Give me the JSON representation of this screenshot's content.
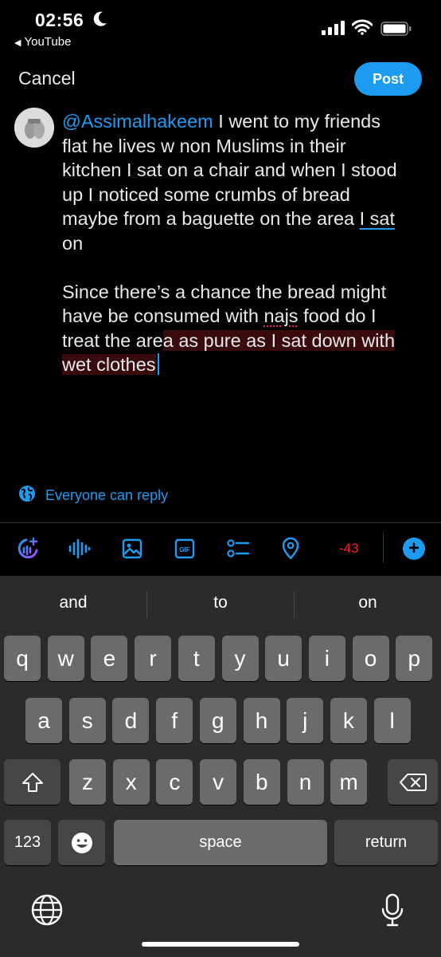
{
  "status": {
    "time": "02:56",
    "back_app": "YouTube"
  },
  "header": {
    "cancel_label": "Cancel",
    "post_label": "Post"
  },
  "compose": {
    "mention": "@Assimalhakeem",
    "line1_rest": " I went to my friends",
    "line2": "flat he lives w non Muslims in their",
    "line3": "kitchen I sat on a chair and when I stood",
    "line4": "up I noticed some crumbs of bread",
    "line5_pre": "maybe from a baguette on the area ",
    "line5_ul": "I sat",
    "line6": "on",
    "line7": "Since there’s a chance the bread might",
    "line8_pre": "have be consumed with ",
    "line8_ul": "najs",
    "line8_post": " food do I",
    "line9_pre": "treat the are",
    "line9_hl": "a as pure as I sat down with",
    "line10_hl": "wet clothes"
  },
  "reply_setting": "Everyone can reply",
  "toolbar": {
    "char_count": "-43",
    "icons": [
      "grok-icon",
      "audio-icon",
      "image-icon",
      "gif-icon",
      "poll-icon",
      "location-icon"
    ],
    "gif_label": "GIF"
  },
  "keyboard": {
    "suggestions": [
      "and",
      "to",
      "on"
    ],
    "row1": [
      "q",
      "w",
      "e",
      "r",
      "t",
      "y",
      "u",
      "i",
      "o",
      "p"
    ],
    "row2": [
      "a",
      "s",
      "d",
      "f",
      "g",
      "h",
      "j",
      "k",
      "l"
    ],
    "row3": [
      "z",
      "x",
      "c",
      "v",
      "b",
      "n",
      "m"
    ],
    "numbers_label": "123",
    "space_label": "space",
    "return_label": "return"
  },
  "colors": {
    "accent": "#1d9bf0",
    "negative": "#f4212e",
    "highlight": "#3a0b0d"
  }
}
